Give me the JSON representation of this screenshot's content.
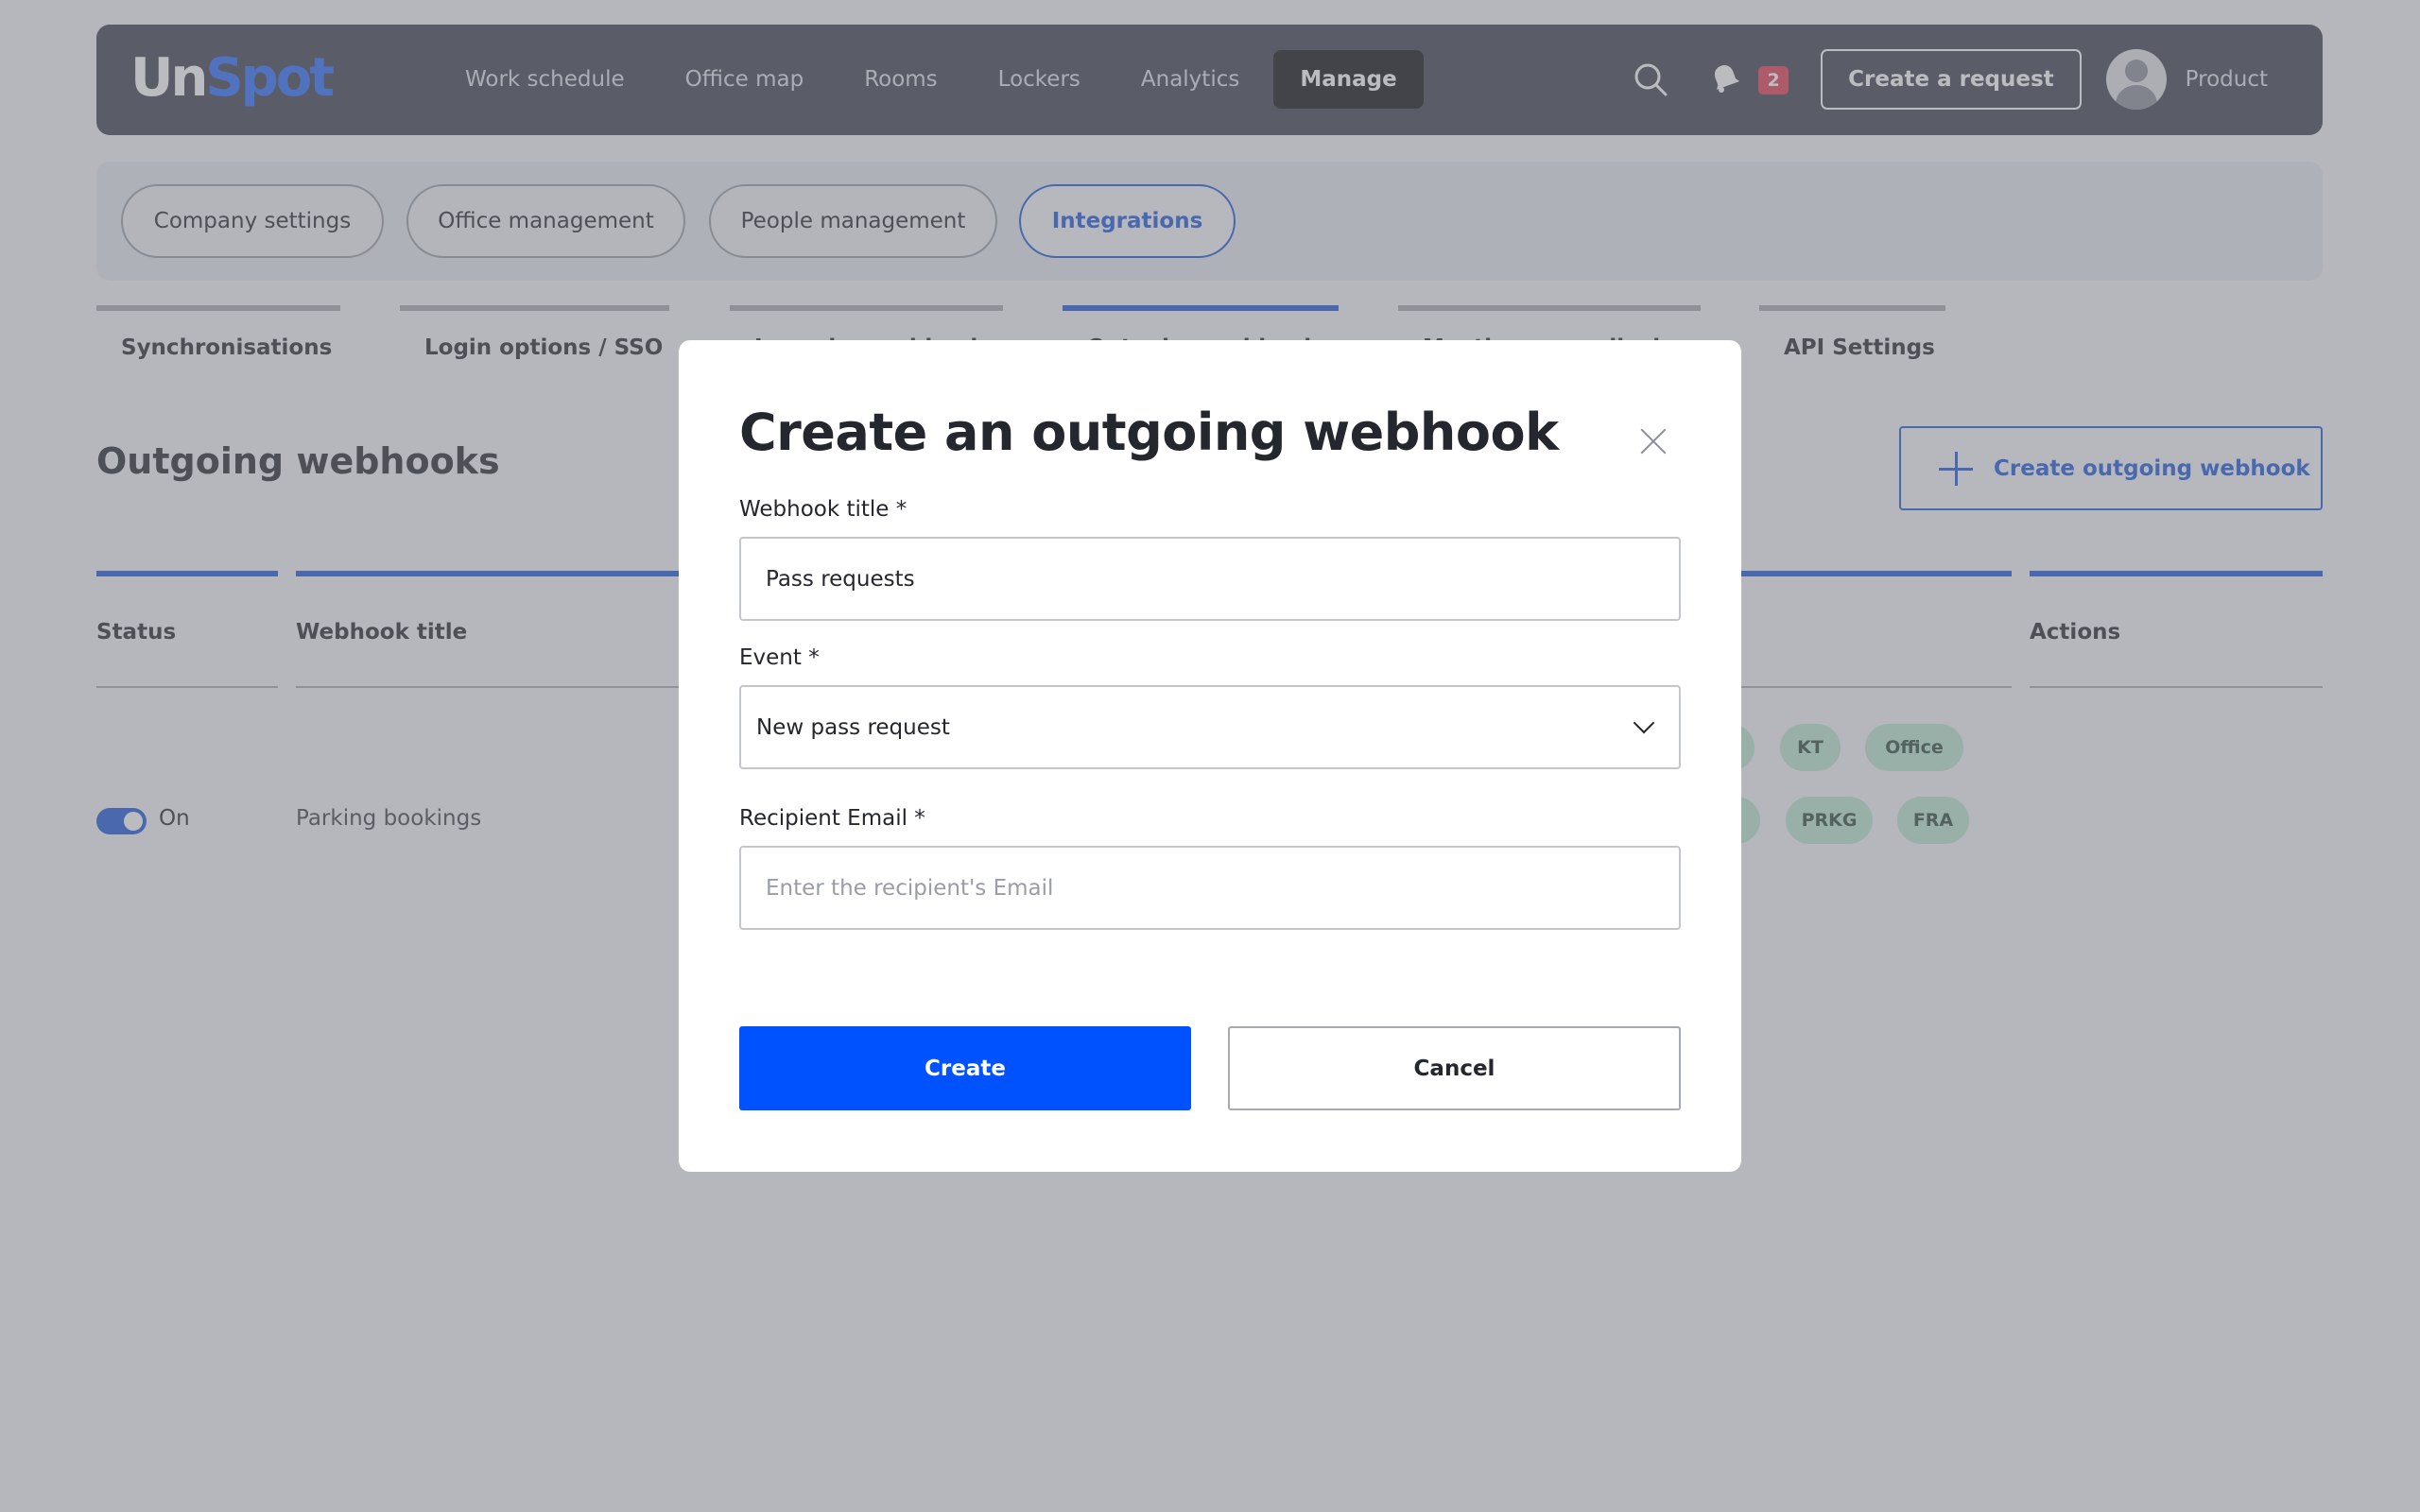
{
  "app": {
    "logo_un": "Un",
    "logo_spot": "Spot"
  },
  "nav": {
    "items": [
      "Work schedule",
      "Office map",
      "Rooms",
      "Lockers",
      "Analytics",
      "Manage"
    ],
    "active": "Manage"
  },
  "header": {
    "notification_count": "2",
    "create_request_label": "Create a request",
    "user_name": "Product",
    "icons": [
      "search-icon",
      "bell-icon",
      "avatar"
    ]
  },
  "sections": {
    "items": [
      "Company settings",
      "Office management",
      "People management",
      "Integrations"
    ],
    "active": "Integrations"
  },
  "subtabs": {
    "items": [
      "Synchronisations",
      "Login options / SSO",
      "Incoming webhooks",
      "Outgoing webhooks",
      "Meeting room displays",
      "API Settings"
    ],
    "active": "Outgoing webhooks"
  },
  "page": {
    "title": "Outgoing webhooks",
    "create_button_label": "Create outgoing webhook"
  },
  "table": {
    "columns": [
      "Status",
      "Webhook title",
      "Actions"
    ],
    "row": {
      "status_label": "On",
      "title": "Parking bookings",
      "tags_row1": [
        "KT",
        "Office"
      ],
      "tags_row2": [
        "PRKG",
        "FRA"
      ]
    }
  },
  "modal": {
    "title": "Create an outgoing webhook",
    "webhook_title_label": "Webhook title *",
    "webhook_title_value": "Pass requests",
    "event_label": "Event *",
    "event_value": "New pass request",
    "recipient_label": "Recipient Email *",
    "recipient_placeholder": "Enter the recipient's Email",
    "create_label": "Create",
    "cancel_label": "Cancel"
  },
  "colors": {
    "accent": "#1a56db",
    "primary_button": "#0052ff",
    "topbar": "#3d4150",
    "tag": "#b8e6cf",
    "badge": "#e23a55"
  }
}
